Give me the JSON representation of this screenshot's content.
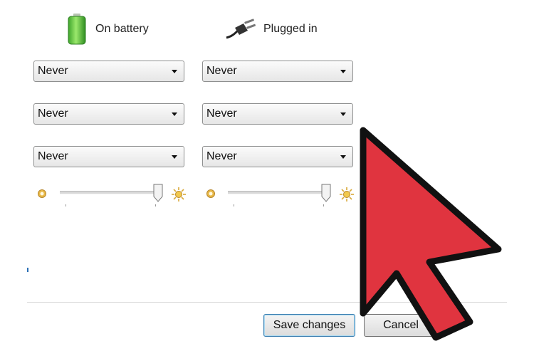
{
  "columns": {
    "battery": {
      "label": "On battery",
      "icon": "battery-icon"
    },
    "plugged": {
      "label": "Plugged in",
      "icon": "power-plug-icon"
    }
  },
  "settings": {
    "row1": {
      "battery": "Never",
      "plugged": "Never"
    },
    "row2": {
      "battery": "Never",
      "plugged": "Never"
    },
    "row3": {
      "battery": "Never",
      "plugged": "Never"
    }
  },
  "brightness": {
    "battery_level": 0.97,
    "plugged_level": 0.97,
    "dim_icon": "sun-dim-icon",
    "bright_icon": "sun-bright-icon"
  },
  "buttons": {
    "save": "Save changes",
    "cancel": "Cancel"
  },
  "overlay": {
    "icon": "cursor-arrow-icon",
    "color": "#e0343f"
  }
}
